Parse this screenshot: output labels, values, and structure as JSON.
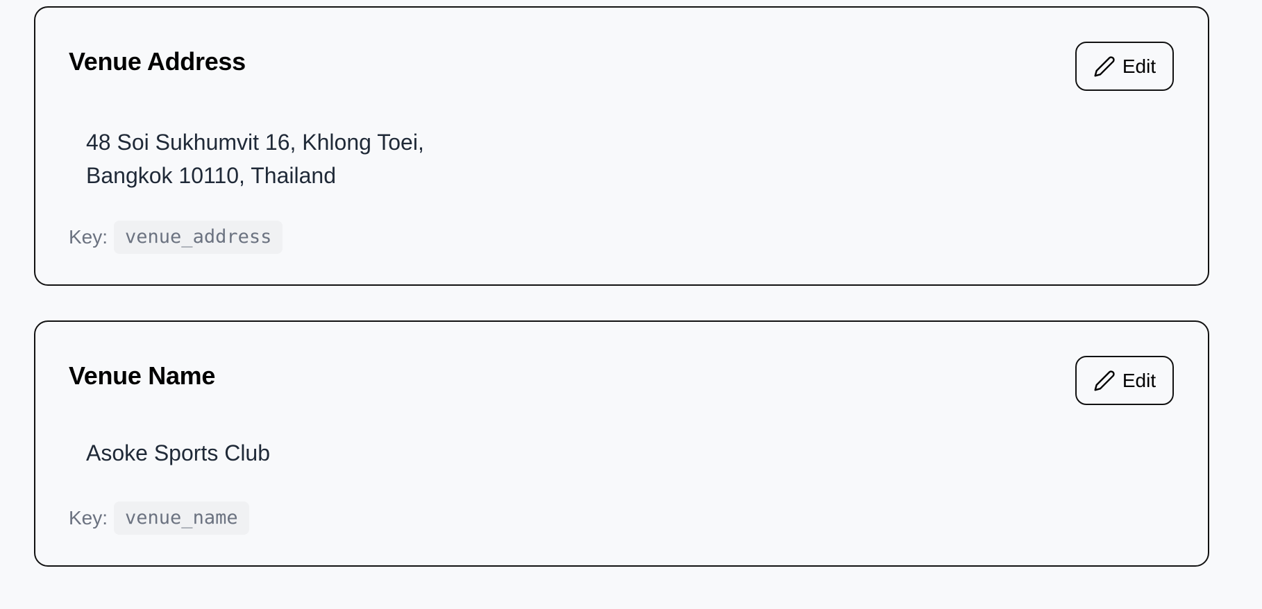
{
  "settings": [
    {
      "title": "Venue Address",
      "edit_label": "Edit",
      "value_lines": [
        "48 Soi Sukhumvit 16, Khlong Toei,",
        "Bangkok 10110, Thailand"
      ],
      "key_label": "Key:",
      "key": "venue_address"
    },
    {
      "title": "Venue Name",
      "edit_label": "Edit",
      "value_lines": [
        "Asoke Sports Club"
      ],
      "key_label": "Key:",
      "key": "venue_name"
    }
  ],
  "icons": {
    "edit": "pencil-icon"
  },
  "colors": {
    "background": "#f8f9fb",
    "border": "#111111",
    "value_text": "#1f2937",
    "muted_text": "#6b7280",
    "code_background": "#f0f1f3"
  }
}
